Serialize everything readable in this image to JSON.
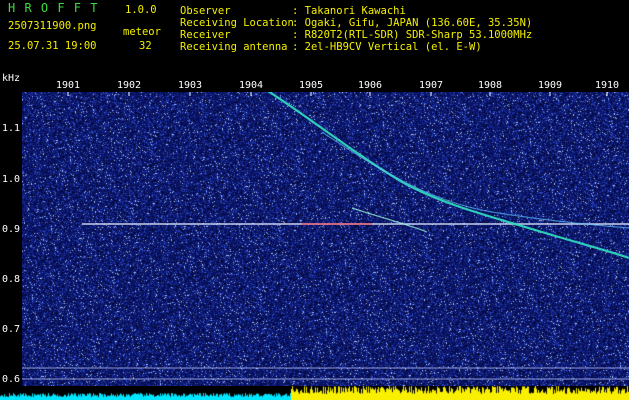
{
  "header": {
    "app_name": "H R O F F T",
    "version": "1.0.0",
    "filename": "2507311900.png",
    "datetime": "25.07.31 19:00",
    "meteor_label": "meteor",
    "meteor_count": "32",
    "fields": [
      {
        "key": "Observer",
        "value": ": Takanori Kawachi"
      },
      {
        "key": "Receiving Location",
        "value": ": Ogaki, Gifu, JAPAN (136.60E, 35.35N)"
      },
      {
        "key": "Receiver",
        "value": ": R820T2(RTL-SDR) SDR-Sharp 53.1000MHz"
      },
      {
        "key": "Receiving antenna",
        "value": ": 2el-HB9CV Vertical (el. E-W)"
      }
    ]
  },
  "axis": {
    "unit": "kHz",
    "x_ticks": [
      "1901",
      "1902",
      "1903",
      "1904",
      "1905",
      "1906",
      "1907",
      "1908",
      "1909",
      "1910"
    ],
    "y_ticks": [
      "1.1",
      "1.0",
      "0.9",
      "0.8",
      "0.7",
      "0.6"
    ]
  },
  "colors": {
    "background": "#000000",
    "noise": "#1a2a8c",
    "carrier": "#ffffff",
    "meteor_trace": "#30e0c0",
    "signal_level_low": "#00e6ff",
    "signal_level_high": "#f8f000",
    "header_green": "#3cdc3c",
    "header_yellow": "#f4f000"
  }
}
